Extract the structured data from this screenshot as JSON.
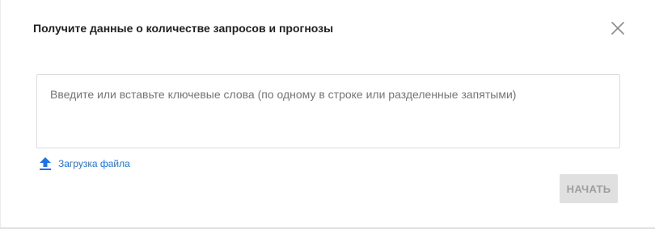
{
  "dialog": {
    "title": "Получите данные о количестве запросов и прогнозы",
    "close_icon": "close-icon"
  },
  "keywords": {
    "value": "",
    "placeholder": "Введите или вставьте ключевые слова (по одному в строке или разделенные запятыми)"
  },
  "upload": {
    "icon": "upload-icon",
    "label": "Загрузка файла"
  },
  "actions": {
    "start_label": "НАЧАТЬ",
    "start_enabled": false
  },
  "colors": {
    "link": "#1a73e8",
    "title": "#212121",
    "disabled_button_bg": "#e0e0e0",
    "disabled_button_text": "#9e9e9e"
  }
}
